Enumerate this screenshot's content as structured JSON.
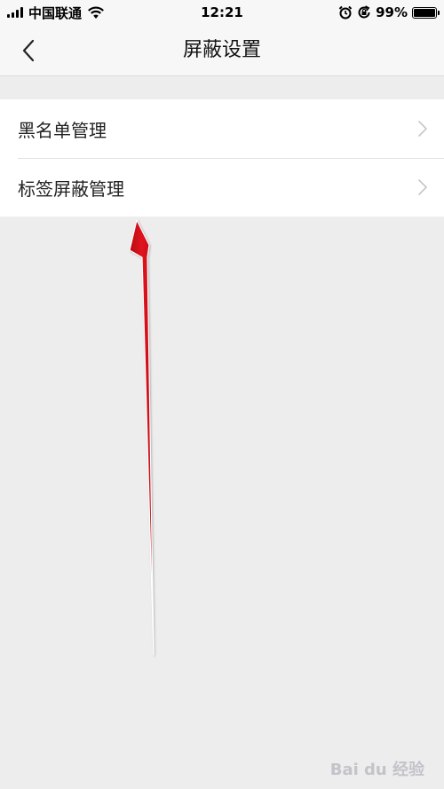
{
  "status_bar": {
    "carrier": "中国联通",
    "time": "12:21",
    "battery": "99%",
    "battery_level": 0.99,
    "icons": [
      "signal-icon",
      "wifi-icon",
      "alarm-icon",
      "orientation-lock-icon",
      "battery-icon"
    ]
  },
  "nav": {
    "back_icon": "chevron-left-icon",
    "title": "屏蔽设置"
  },
  "list": {
    "items": [
      {
        "label": "黑名单管理",
        "icon": "chevron-right-icon"
      },
      {
        "label": "标签屏蔽管理",
        "icon": "chevron-right-icon"
      }
    ]
  },
  "annotation": {
    "type": "red-arrow",
    "color": "#e0141e"
  },
  "watermark": {
    "text": "Bai du 经验"
  },
  "colors": {
    "background": "#ededed",
    "nav_background": "#f7f7f7",
    "list_background": "#ffffff",
    "chevron": "#c7c7cc"
  }
}
